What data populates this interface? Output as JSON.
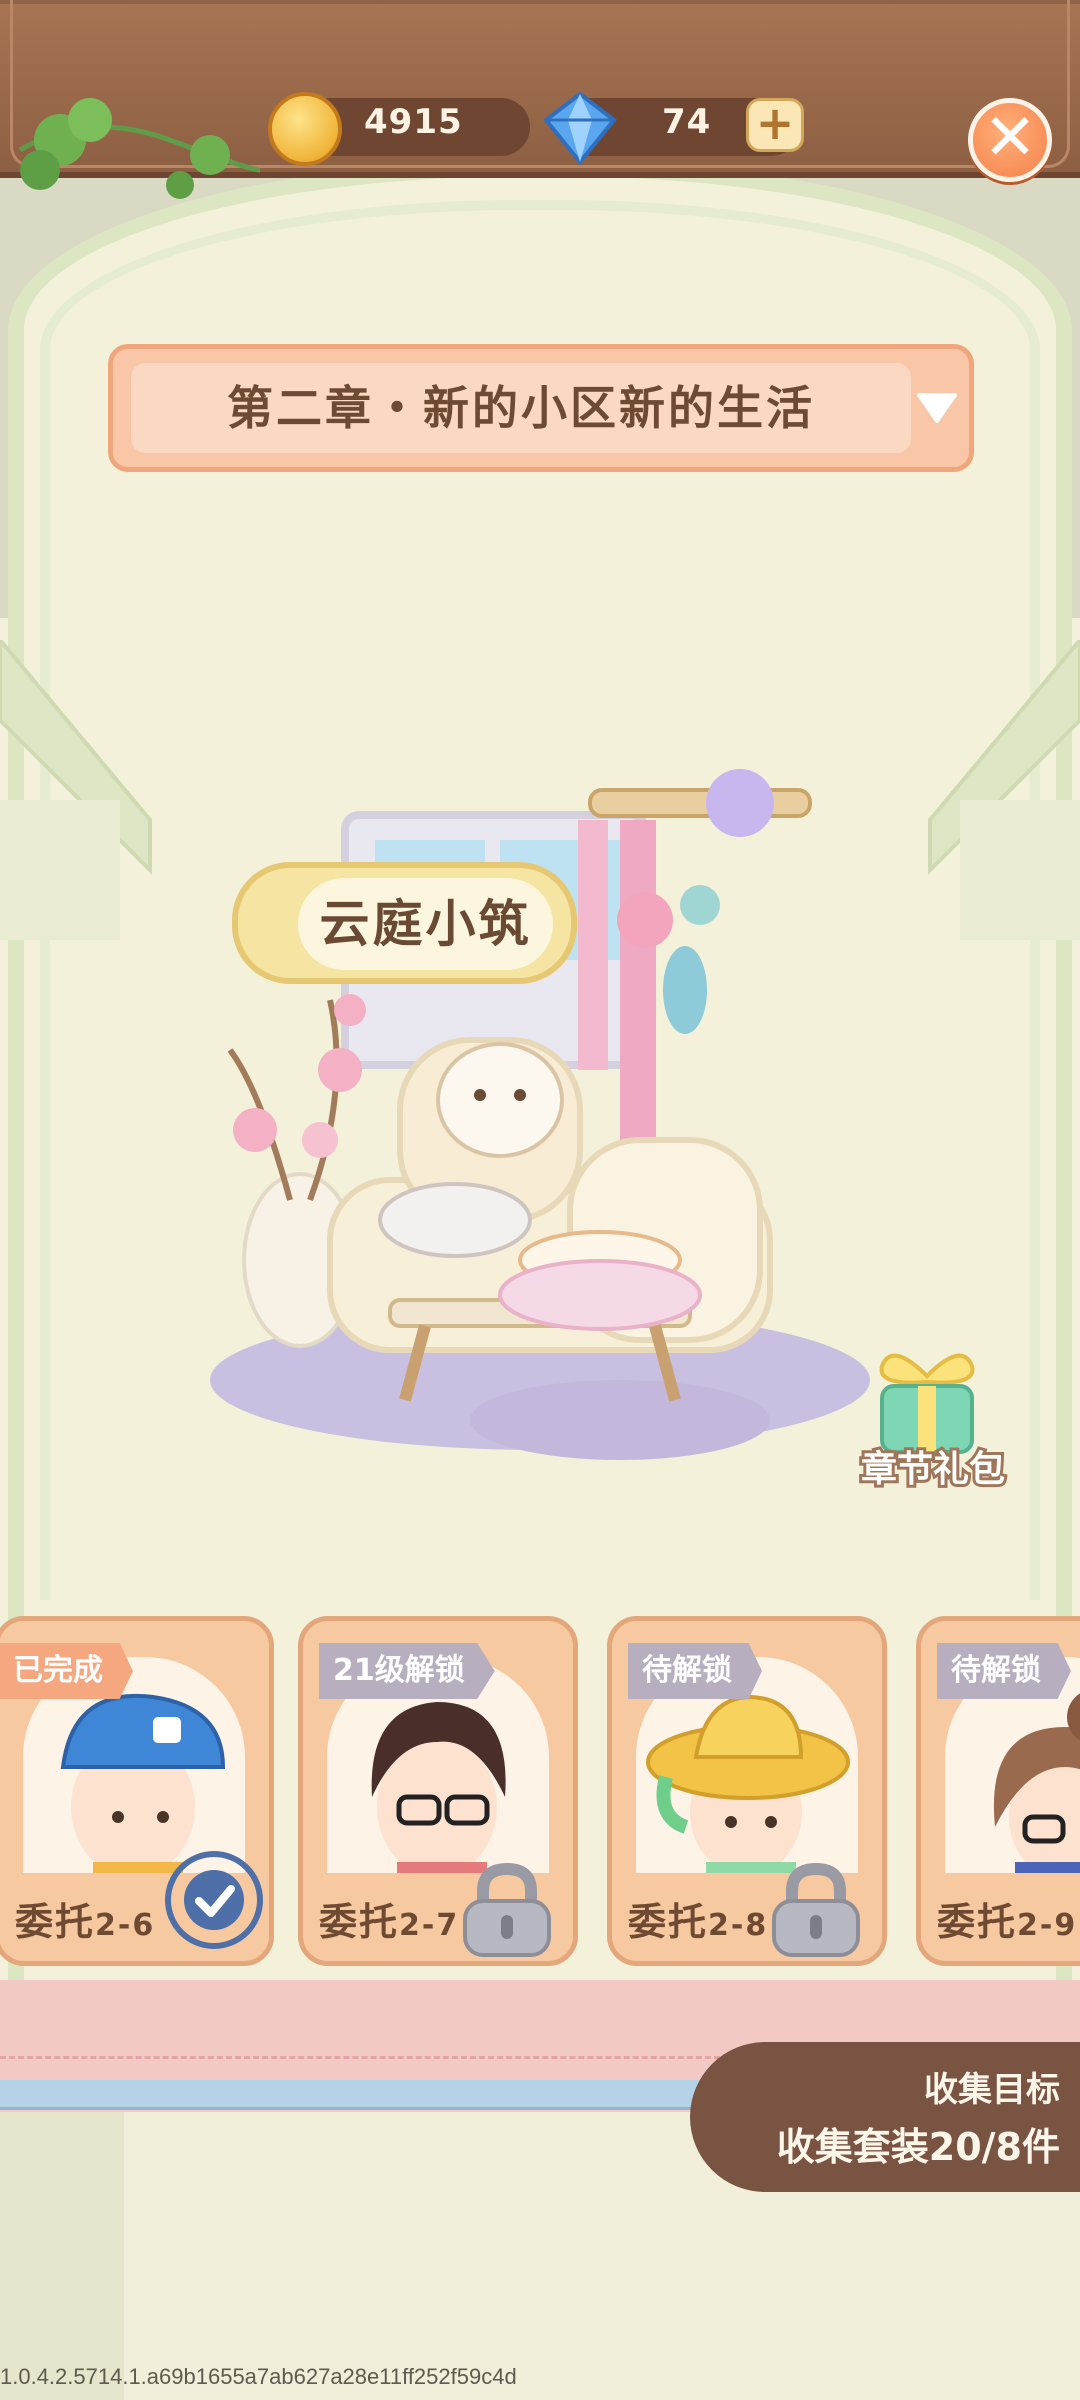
{
  "resources": {
    "coins": "4915",
    "gems": "74"
  },
  "chapter": {
    "title": "第二章・新的小区新的生活"
  },
  "room": {
    "name": "云庭小筑"
  },
  "gift": {
    "label": "章节礼包"
  },
  "cards": [
    {
      "tag": "已完成",
      "name": "委托",
      "num": "2-6",
      "state": "completed"
    },
    {
      "tag": "21级解锁",
      "name": "委托",
      "num": "2-7",
      "state": "locked"
    },
    {
      "tag": "待解锁",
      "name": "委托",
      "num": "2-8",
      "state": "locked"
    },
    {
      "tag": "待解锁",
      "name": "委托",
      "num": "2-9",
      "state": "locked"
    }
  ],
  "goal": {
    "title": "收集目标",
    "text": "收集套装20/8件"
  },
  "version": "1.0.4.2.5714.1.a69b1655a7ab627a28e11ff252f59c4d",
  "colors": {
    "accent_orange": "#f5804a",
    "banner_peach": "#f9c7a8",
    "card_bg": "#f6c9a0",
    "goal_brown": "#7a5443"
  }
}
